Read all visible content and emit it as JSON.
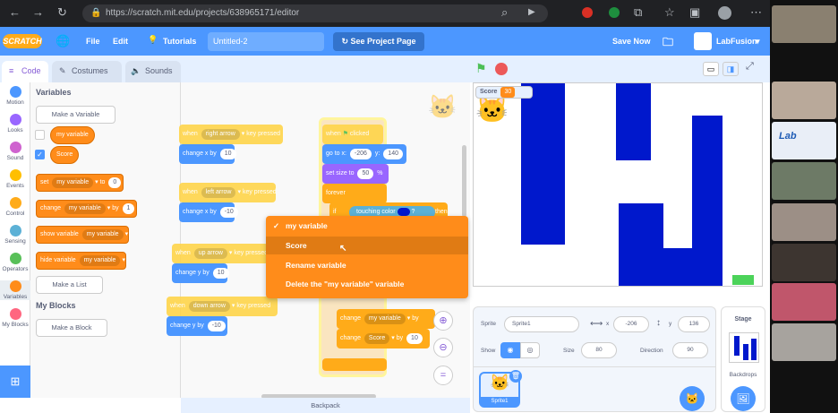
{
  "browser": {
    "url": "https://scratch.mit.edu/projects/638965171/editor"
  },
  "menubar": {
    "logo": "SCRATCH",
    "file": "File",
    "edit": "Edit",
    "tutorials": "Tutorials",
    "project_title": "Untitled-2",
    "see_project_page": "See Project Page",
    "save_now": "Save Now",
    "username": "LabFusion"
  },
  "tabs": {
    "code": "Code",
    "costumes": "Costumes",
    "sounds": "Sounds"
  },
  "categories": [
    {
      "label": "Motion",
      "color": "#4c97ff"
    },
    {
      "label": "Looks",
      "color": "#9966ff"
    },
    {
      "label": "Sound",
      "color": "#cf63cf"
    },
    {
      "label": "Events",
      "color": "#ffbf00"
    },
    {
      "label": "Control",
      "color": "#ffab19"
    },
    {
      "label": "Sensing",
      "color": "#5cb1d6"
    },
    {
      "label": "Operators",
      "color": "#59c059"
    },
    {
      "label": "Variables",
      "color": "#ff8c1a"
    },
    {
      "label": "My Blocks",
      "color": "#ff6680"
    }
  ],
  "palette": {
    "heading": "Variables",
    "make_variable": "Make a Variable",
    "var1": "my variable",
    "var2": "Score",
    "set_text": "set",
    "set_var": "my variable",
    "set_to": "to",
    "set_value": "0",
    "change_text": "change",
    "change_var": "my variable",
    "change_by": "by",
    "change_value": "1",
    "show_text": "show variable",
    "show_var": "my variable",
    "hide_text": "hide variable",
    "hide_var": "my variable",
    "make_list": "Make a List",
    "myblocks_heading": "My Blocks",
    "make_block": "Make a Block"
  },
  "workspace": {
    "s1_when": "when",
    "s1_key": "right arrow",
    "s1_pressed": "key pressed",
    "s1_change": "change x by",
    "s1_val": "10",
    "s2_when": "when",
    "s2_key": "left arrow",
    "s2_pressed": "key pressed",
    "s2_change": "change x by",
    "s2_val": "-10",
    "s3_when": "when",
    "s3_key": "up arrow",
    "s3_pressed": "key pressed",
    "s3_change": "change y by",
    "s3_val": "10",
    "s4_when": "when",
    "s4_key": "down arrow",
    "s4_pressed": "key pressed",
    "s4_change": "change y by",
    "s4_val": "-10",
    "main_when": "when",
    "main_clicked": "clicked",
    "goto_text": "go to x:",
    "goto_x": "-206",
    "goto_y_label": "y:",
    "goto_y": "140",
    "size_text": "set size to",
    "size_val": "50",
    "size_pct": "%",
    "forever": "forever",
    "if_text": "if",
    "touching": "touching color",
    "then": "then",
    "ch1_text": "change",
    "ch1_var": "my variable",
    "ch1_by": "by",
    "ch2_text": "change",
    "ch2_var": "Score",
    "ch2_by": "by",
    "ch2_val": "10"
  },
  "context_menu": {
    "items": [
      "my variable",
      "Score",
      "Rename variable",
      "Delete the \"my variable\" variable"
    ],
    "checked_index": 0,
    "highlighted_index": 1
  },
  "stage": {
    "monitor_label": "Score",
    "monitor_value": "30"
  },
  "sprite_info": {
    "sprite_label": "Sprite",
    "sprite_name": "Sprite1",
    "x_label": "x",
    "x_value": "-206",
    "y_label": "y",
    "y_value": "136",
    "show_label": "Show",
    "size_label": "Size",
    "size_value": "80",
    "direction_label": "Direction",
    "direction_value": "90",
    "thumb_name": "Sprite1"
  },
  "stage_pane": {
    "title": "Stage",
    "backdrops": "Backdrops"
  },
  "backpack": "Backpack",
  "colors": {
    "scratch_blue": "#4c97ff",
    "variables_orange": "#ff8c1a",
    "maze_blue": "#0018cc"
  }
}
